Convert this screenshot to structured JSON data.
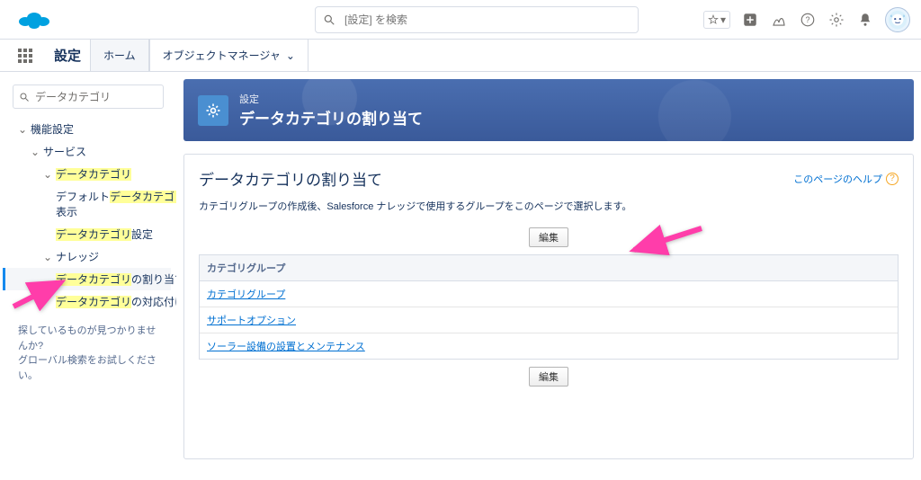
{
  "top": {
    "search_placeholder": "[設定] を検索"
  },
  "nav": {
    "app_name": "設定",
    "tab_home": "ホーム",
    "tab_object_manager": "オブジェクトマネージャ"
  },
  "sidebar": {
    "quick_find": "データカテゴリ",
    "n0": "機能設定",
    "n1": "サービス",
    "n2": "データカテゴリ",
    "n3a": "デフォルト",
    "n3b": "データカテゴリ",
    "n3c": "表示",
    "n4a": "データカテゴリ",
    "n4b": "設定",
    "n5": "ナレッジ",
    "n6a": "データカテゴリ",
    "n6b": "の割り当て",
    "n7a": "データカテゴリ",
    "n7b": "の対応付け",
    "nofind1": "探しているものが見つかりませんか?",
    "nofind2": "グローバル検索をお試しください。"
  },
  "main": {
    "crumb": "設定",
    "title": "データカテゴリの割り当て",
    "panel_title": "データカテゴリの割り当て",
    "help": "このページのヘルプ",
    "desc": "カテゴリグループの作成後、Salesforce ナレッジで使用するグループをこのページで選択します。",
    "edit": "編集",
    "group_header": "カテゴリグループ",
    "groups": {
      "g0": "カテゴリグループ",
      "g1": "サポートオプション",
      "g2": "ソーラー設備の設置とメンテナンス"
    }
  }
}
